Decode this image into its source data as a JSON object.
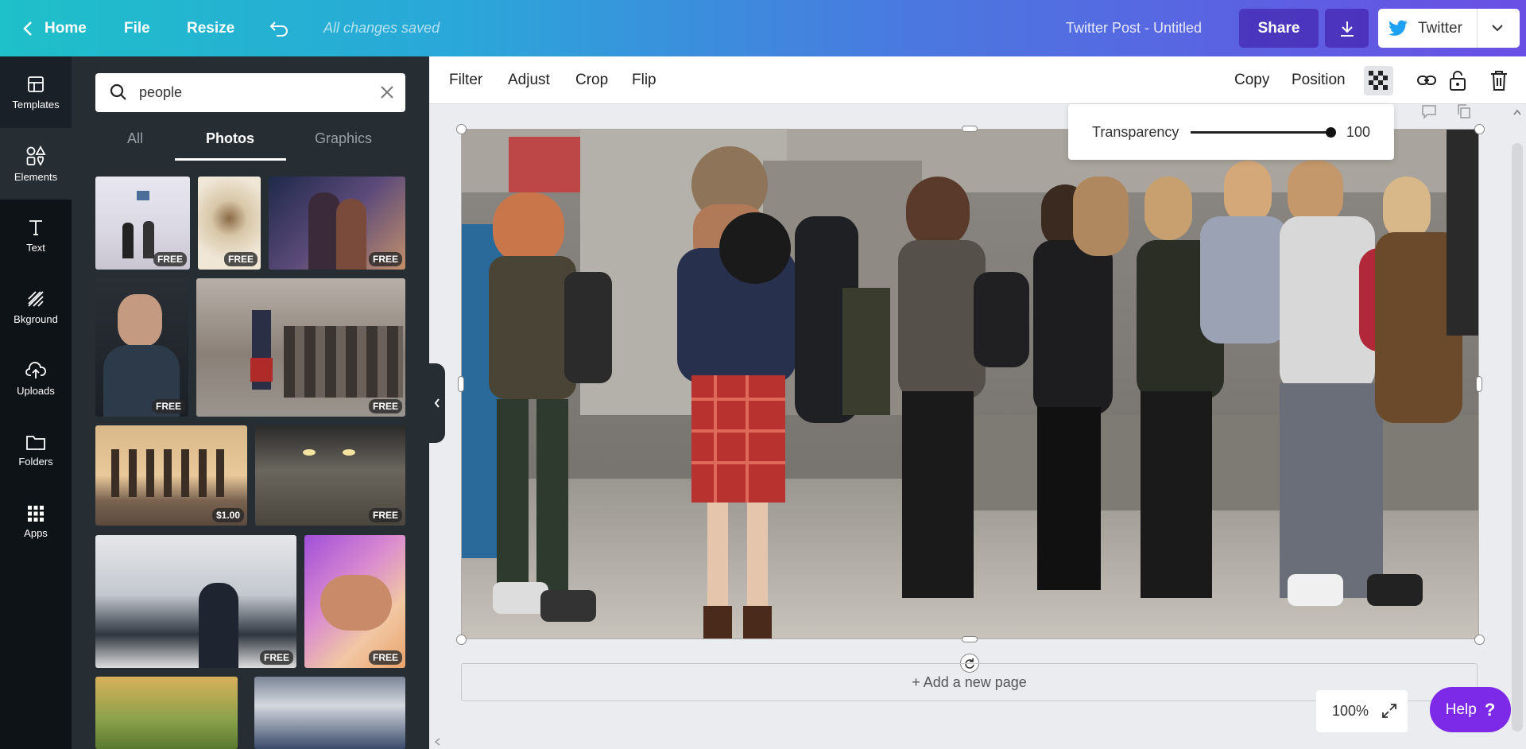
{
  "topbar": {
    "home": "Home",
    "file": "File",
    "resize": "Resize",
    "saved_status": "All changes saved",
    "doc_title": "Twitter Post - Untitled",
    "share": "Share",
    "publish_target": "Twitter"
  },
  "leftnav": {
    "items": [
      {
        "label": "Templates",
        "icon": "templates-icon"
      },
      {
        "label": "Elements",
        "icon": "elements-icon"
      },
      {
        "label": "Text",
        "icon": "text-icon"
      },
      {
        "label": "Bkground",
        "icon": "background-icon"
      },
      {
        "label": "Uploads",
        "icon": "upload-icon"
      },
      {
        "label": "Folders",
        "icon": "folder-icon"
      },
      {
        "label": "Apps",
        "icon": "apps-icon"
      }
    ]
  },
  "panel": {
    "search_value": "people",
    "tabs": [
      "All",
      "Photos",
      "Graphics"
    ],
    "selected_tab": "Photos",
    "thumbs": [
      {
        "badge": "FREE"
      },
      {
        "badge": "FREE"
      },
      {
        "badge": "FREE"
      },
      {
        "badge": "FREE"
      },
      {
        "badge": "FREE"
      },
      {
        "badge": "$1.00"
      },
      {
        "badge": "FREE"
      },
      {
        "badge": "FREE"
      },
      {
        "badge": "FREE"
      }
    ]
  },
  "editor_toolbar": {
    "filter": "Filter",
    "adjust": "Adjust",
    "crop": "Crop",
    "flip": "Flip",
    "copy": "Copy",
    "position": "Position"
  },
  "transparency": {
    "label": "Transparency",
    "value": "100",
    "level": 1.0
  },
  "canvas": {
    "add_page": "+ Add a new page"
  },
  "zoom": {
    "level": "100%"
  },
  "help": {
    "label": "Help",
    "glyph": "?"
  },
  "colors": {
    "accent_purple": "#7d2ae8",
    "sidebar": "#0e1318",
    "panel": "#262d33"
  }
}
